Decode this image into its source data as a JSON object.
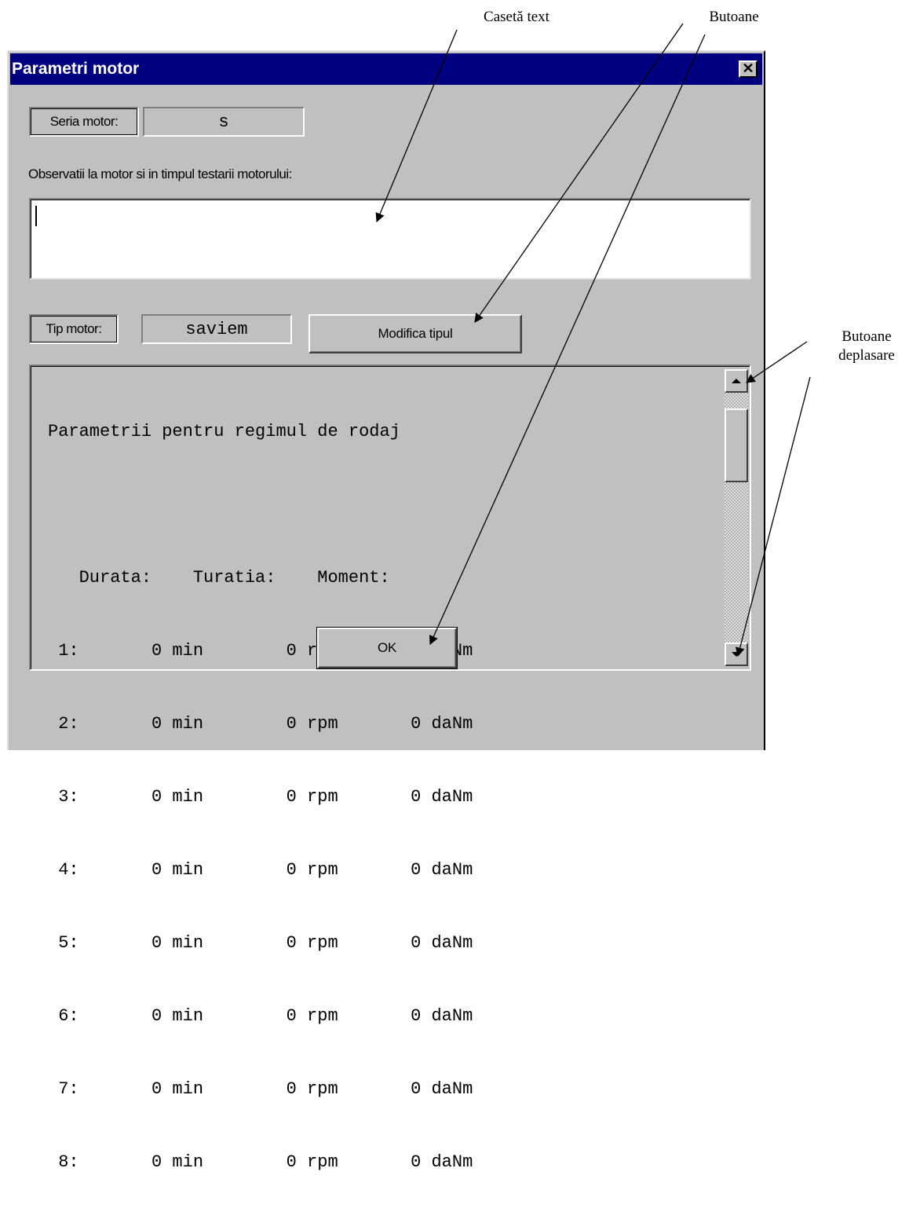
{
  "annotations": {
    "text_box": "Casetă text",
    "buttons": "Butoane",
    "scroll_buttons_line1": "Butoane",
    "scroll_buttons_line2": "deplasare"
  },
  "window": {
    "title": "Parametri motor",
    "close_glyph": "✕"
  },
  "engine_series": {
    "label": "Seria motor:",
    "value": "s"
  },
  "observations": {
    "label": "Observatii la motor si in timpul testarii motorului:",
    "value": ""
  },
  "engine_type": {
    "label": "Tip motor:",
    "value": "saviem",
    "modify_button": "Modifica tipul"
  },
  "parameters": {
    "title": "Parametrii pentru regimul de rodaj",
    "header": "   Durata:    Turatia:    Moment:",
    "rows": [
      " 1:       0 min        0 rpm       0 daNm",
      " 2:       0 min        0 rpm       0 daNm",
      " 3:       0 min        0 rpm       0 daNm",
      " 4:       0 min        0 rpm       0 daNm",
      " 5:       0 min        0 rpm       0 daNm",
      " 6:       0 min        0 rpm       0 daNm",
      " 7:       0 min        0 rpm       0 daNm",
      " 8:       0 min        0 rpm       0 daNm"
    ]
  },
  "ok_button": "OK"
}
